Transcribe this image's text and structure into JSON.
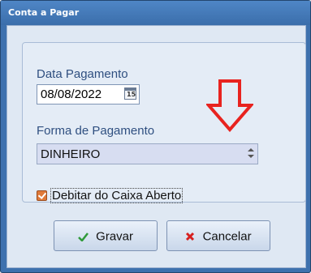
{
  "window": {
    "title": "Conta a Pagar"
  },
  "form": {
    "date_label": "Data Pagamento",
    "date_value": "08/08/2022",
    "calendar_icon": "calendar-icon",
    "payment_label": "Forma de Pagamento",
    "payment_value": "DINHEIRO",
    "debit_checkbox": {
      "label": "Debitar do Caixa Aberto",
      "checked": true
    }
  },
  "annotation": {
    "arrow_icon": "down-arrow-icon",
    "color": "#e8231f"
  },
  "buttons": {
    "save_label": "Gravar",
    "save_icon": "checkmark-icon",
    "cancel_label": "Cancelar",
    "cancel_icon": "x-icon"
  },
  "colors": {
    "titlebar": "#3e71ae",
    "client_bg": "#dfe8f3",
    "label_text": "#2f4f80",
    "select_bg": "#d7ddf1",
    "checkbox": "#e07a3a"
  }
}
